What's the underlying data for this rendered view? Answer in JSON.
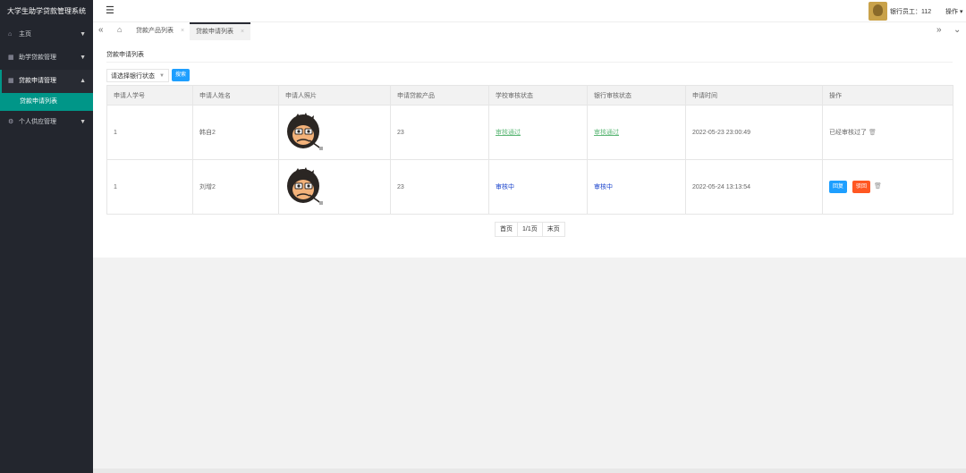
{
  "app_title": "大学生助学贷款管理系统",
  "sidebar": {
    "items": [
      {
        "label": "主页",
        "icon": "home-icon"
      },
      {
        "label": "助学贷款管理",
        "icon": "calendar-icon"
      },
      {
        "label": "贷款申请管理",
        "icon": "calendar-icon",
        "open": true,
        "children": [
          {
            "label": "贷款申请列表"
          }
        ]
      },
      {
        "label": "个人供应管理",
        "icon": "gear-icon"
      }
    ]
  },
  "header": {
    "menu_icon": "menu-toggle-icon",
    "user_label": "银行员工：112",
    "ops_label": "操作"
  },
  "tabs": [
    {
      "label": "贷款产品列表",
      "close": "×"
    },
    {
      "label": "贷款申请列表",
      "close": "×",
      "active": true
    }
  ],
  "main": {
    "panel_title": "贷款申请列表",
    "filter_select": "请选择银行状态",
    "search_label": "搜索",
    "columns": [
      "申请人学号",
      "申请人姓名",
      "申请人照片",
      "申请贷款产品",
      "学校审核状态",
      "银行审核状态",
      "申请时间",
      "操作"
    ],
    "rows": [
      {
        "student_id": "1",
        "name": "韩自2",
        "product": "23",
        "school_status": "审核通过",
        "bank_status": "审核通过",
        "time": "2022-05-23 23:00:49",
        "action_text": "已经审核过了"
      },
      {
        "student_id": "1",
        "name": "刘增2",
        "product": "23",
        "school_status": "审核中",
        "bank_status": "审核中",
        "time": "2022-05-24 13:13:54",
        "reply": "回复",
        "reject": "驳回"
      }
    ]
  },
  "pager": {
    "first": "首页",
    "info": "1/1页",
    "last": "末页"
  },
  "colors": {
    "sidebar_bg": "#23262e",
    "accent": "#009688",
    "primary_btn": "#1e9fff",
    "danger_btn": "#ff5722",
    "approved": "#5fb878",
    "pending": "#1a43cc"
  }
}
